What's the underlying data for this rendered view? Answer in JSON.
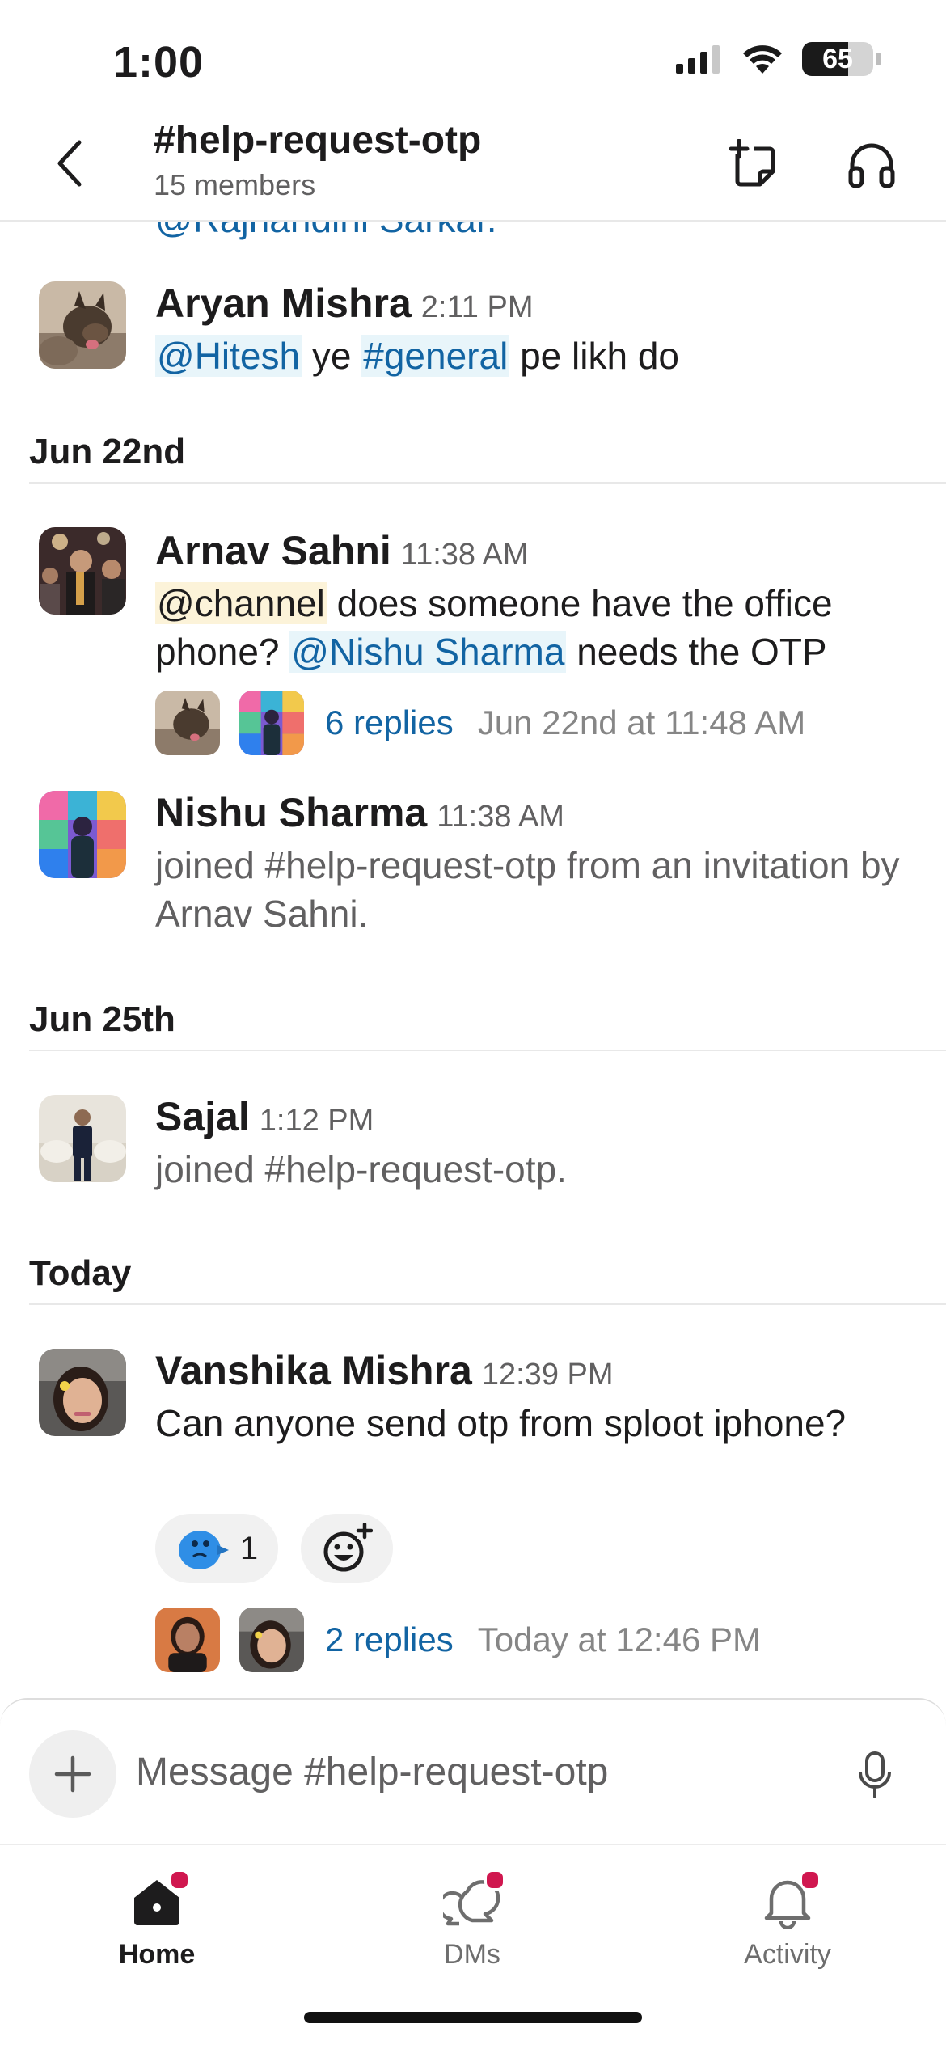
{
  "status_bar": {
    "time": "1:00",
    "battery_percent": "65",
    "battery_level": 0.65
  },
  "header": {
    "back_icon": "chevron-left-icon",
    "title": "#help-request-otp",
    "members": "15 members",
    "canvas_icon": "canvas-add-icon",
    "huddle_icon": "headphones-icon"
  },
  "feed": {
    "cut_off_text": "@Rajnandini Sarkar.",
    "messages": [
      {
        "author": "Aryan Mishra",
        "time": "2:11 PM",
        "mention": "@Hitesh",
        "text_mid": " ye ",
        "channel": "#general",
        "text_end": " pe likh do"
      },
      {
        "author": "Arnav Sahni",
        "time": "11:38 AM",
        "channel_mention": "@channel",
        "text_a": " does someone have the office phone? ",
        "mention": "@Nishu Sharma",
        "text_b": " needs the OTP",
        "thread": {
          "replies": "6 replies",
          "last_reply": "Jun 22nd at 11:48 AM"
        }
      },
      {
        "author": "Nishu Sharma",
        "time": "11:38 AM",
        "system_text": "joined #help-request-otp from an invitation by Arnav Sahni."
      },
      {
        "author": "Sajal",
        "time": "1:12 PM",
        "system_text": "joined #help-request-otp."
      },
      {
        "author": "Vanshika Mishra",
        "time": "12:39 PM",
        "text": "Can anyone send otp from sploot iphone?",
        "reaction": {
          "emoji": "thinking-bird-emoji",
          "count": "1"
        },
        "add_reaction_icon": "add-reaction-icon",
        "thread": {
          "replies": "2 replies",
          "last_reply": "Today at 12:46 PM"
        }
      }
    ],
    "date_dividers": [
      "Jun 22nd",
      "Jun 25th",
      "Today"
    ]
  },
  "composer": {
    "placeholder": "Message #help-request-otp",
    "plus_icon": "plus-icon",
    "mic_icon": "microphone-icon"
  },
  "tabs": [
    {
      "label": "Home",
      "icon": "home-icon",
      "active": true,
      "unread": true
    },
    {
      "label": "DMs",
      "icon": "dm-bubbles-icon",
      "active": false,
      "unread": true
    },
    {
      "label": "Activity",
      "icon": "bell-icon",
      "active": false,
      "unread": true
    }
  ],
  "colors": {
    "link": "#1264a3",
    "mention_bg": "#e8f5fa",
    "channel_mention_bg": "#fcf3d9",
    "unread_dot": "#d0174f"
  }
}
